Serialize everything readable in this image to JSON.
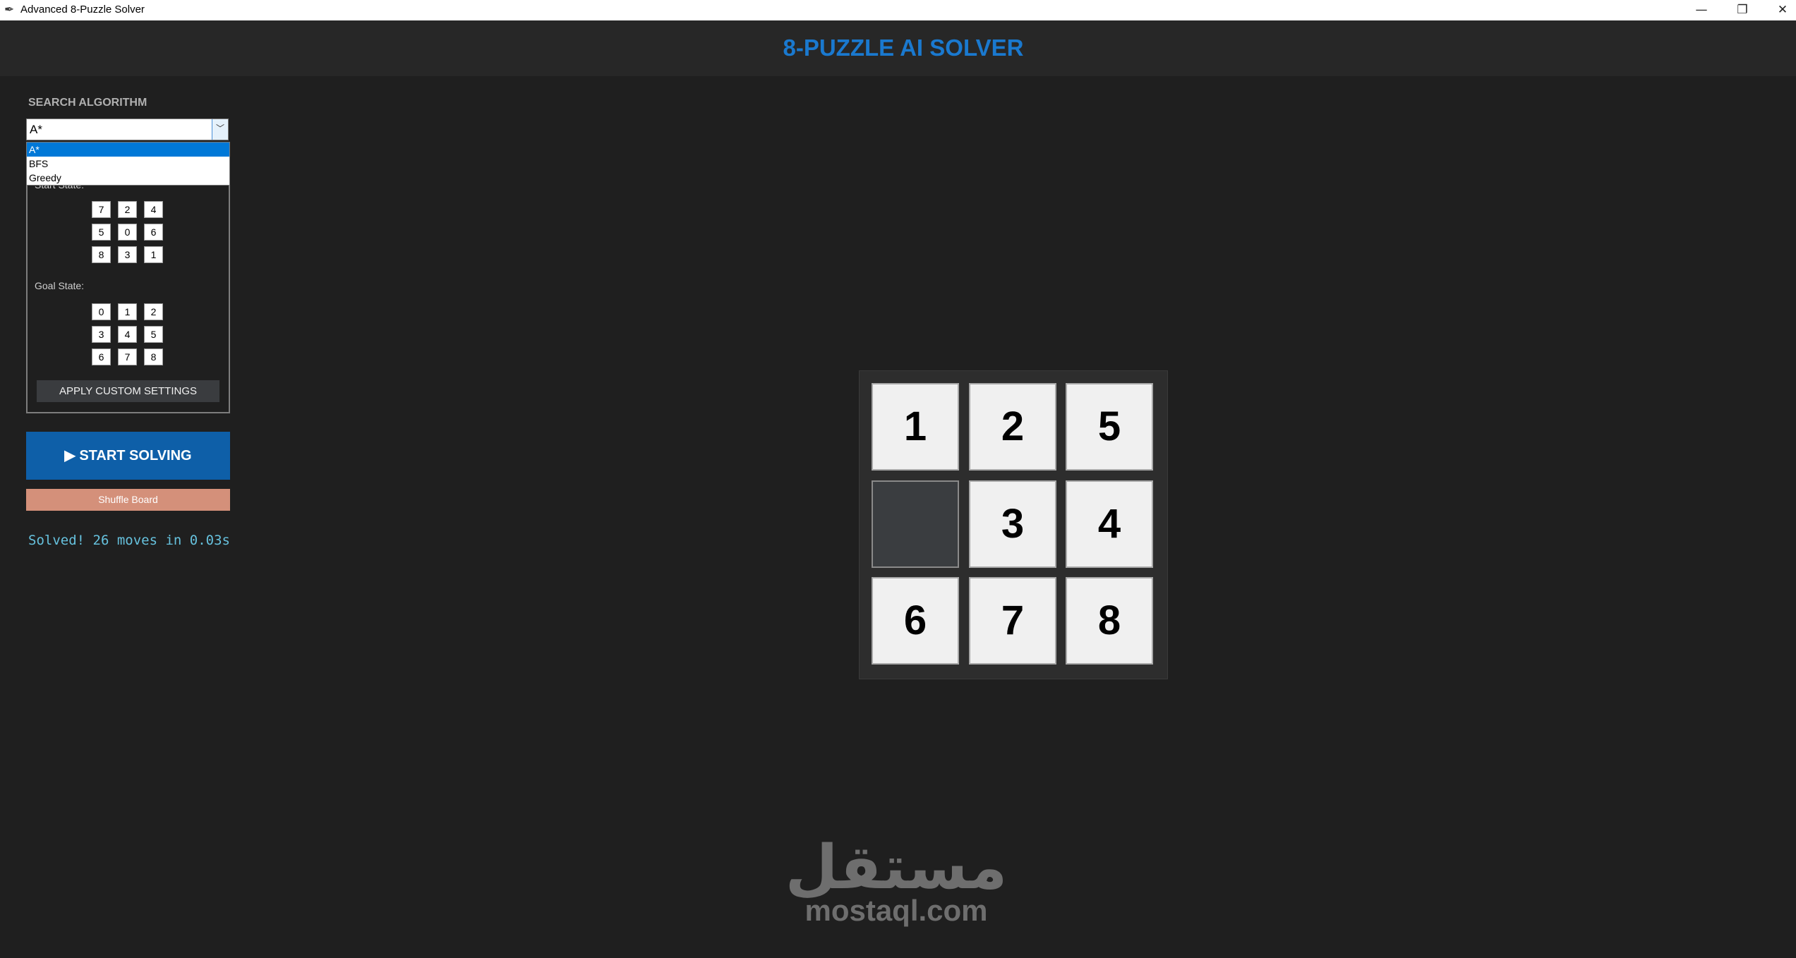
{
  "window": {
    "title": "Advanced 8-Puzzle Solver",
    "icon": "feather-icon",
    "controls": {
      "minimize": "—",
      "restore": "❐",
      "close": "✕"
    }
  },
  "header": {
    "title": "8-PUZZLE AI SOLVER",
    "title_color": "#1a79cf"
  },
  "sidebar": {
    "algorithm_label": "SEARCH ALGORITHM",
    "algorithm_selected": "A*",
    "algorithm_options": [
      "A*",
      "BFS",
      "Greedy"
    ],
    "start_state_label": "Start State:",
    "start_state": [
      [
        "7",
        "2",
        "4"
      ],
      [
        "5",
        "0",
        "6"
      ],
      [
        "8",
        "3",
        "1"
      ]
    ],
    "goal_state_label": "Goal State:",
    "goal_state": [
      [
        "0",
        "1",
        "2"
      ],
      [
        "3",
        "4",
        "5"
      ],
      [
        "6",
        "7",
        "8"
      ]
    ],
    "apply_label": "APPLY CUSTOM SETTINGS",
    "start_label": "▶ START SOLVING",
    "shuffle_label": "Shuffle Board",
    "status": "Solved! 26 moves in 0.03s",
    "colors": {
      "start_button": "#0e5fa8",
      "shuffle_button": "#d4907a",
      "status_text": "#66c1dd"
    }
  },
  "board": {
    "tiles": [
      "1",
      "2",
      "5",
      "",
      "3",
      "4",
      "6",
      "7",
      "8"
    ],
    "blank_color": "#3a3d40"
  },
  "watermark": {
    "arabic": "مستقل",
    "latin": "mostaql.com"
  }
}
